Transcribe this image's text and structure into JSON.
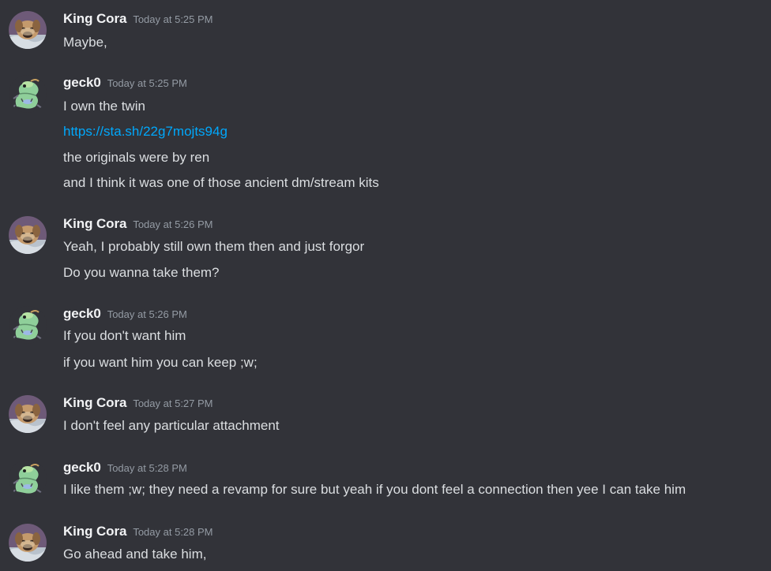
{
  "colors": {
    "background": "#323339",
    "username": "#f2f3f5",
    "timestamp": "#949ba4",
    "text": "#dbdee1",
    "link": "#00a8fc"
  },
  "messages": [
    {
      "author": "King Cora",
      "timestamp": "Today at 5:25 PM",
      "avatar": "dog-avatar",
      "lines": [
        "Maybe,"
      ]
    },
    {
      "author": "geck0",
      "timestamp": "Today at 5:25 PM",
      "avatar": "gecko-avatar",
      "lines": [
        "I own the twin",
        "https://sta.sh/22g7mojts94g",
        "the originals were by ren",
        "and I think it was one of those ancient dm/stream kits"
      ]
    },
    {
      "author": "King Cora",
      "timestamp": "Today at 5:26 PM",
      "avatar": "dog-avatar",
      "lines": [
        "Yeah, I probably still own them then and just forgor",
        "Do you wanna take them?"
      ]
    },
    {
      "author": "geck0",
      "timestamp": "Today at 5:26 PM",
      "avatar": "gecko-avatar",
      "lines": [
        "If you don't want him",
        "if you want him you can keep ;w;"
      ]
    },
    {
      "author": "King Cora",
      "timestamp": "Today at 5:27 PM",
      "avatar": "dog-avatar",
      "lines": [
        "I don't feel any particular attachment"
      ]
    },
    {
      "author": "geck0",
      "timestamp": "Today at 5:28 PM",
      "avatar": "gecko-avatar",
      "lines": [
        "I like them ;w; they need a revamp for sure but yeah if you dont feel a connection then yee I  can take him"
      ]
    },
    {
      "author": "King Cora",
      "timestamp": "Today at 5:28 PM",
      "avatar": "dog-avatar",
      "lines": [
        "Go ahead and take him,"
      ]
    }
  ]
}
